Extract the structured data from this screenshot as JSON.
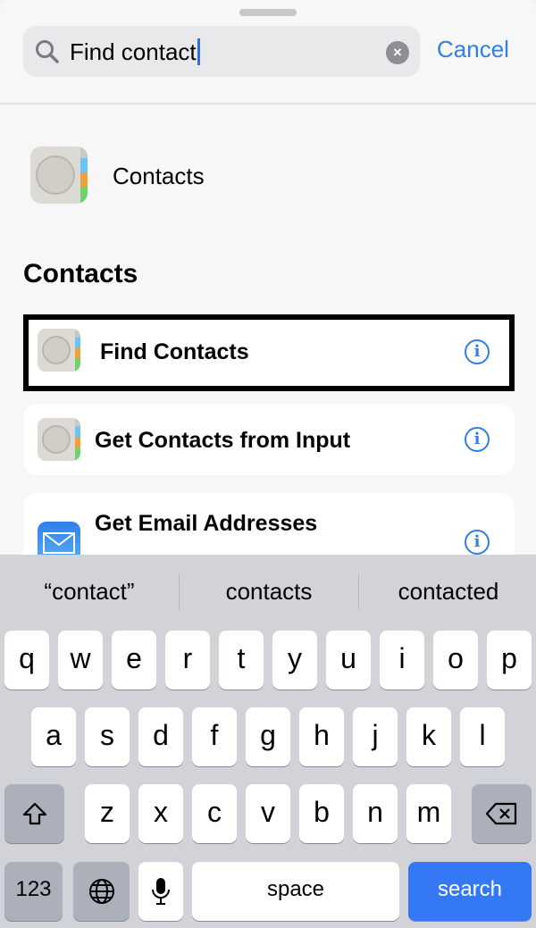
{
  "search": {
    "value": "Find contact",
    "cancel_label": "Cancel"
  },
  "app_result": {
    "label": "Contacts"
  },
  "section_title": "Contacts",
  "actions": [
    {
      "label": "Find Contacts",
      "selected": true
    },
    {
      "label": "Get Contacts from Input"
    },
    {
      "label": "Get Email Addresses"
    }
  ],
  "keyboard": {
    "suggestions": [
      "“contact”",
      "contacts",
      "contacted"
    ],
    "row1": [
      "q",
      "w",
      "e",
      "r",
      "t",
      "y",
      "u",
      "i",
      "o",
      "p"
    ],
    "row2": [
      "a",
      "s",
      "d",
      "f",
      "g",
      "h",
      "j",
      "k",
      "l"
    ],
    "row3": [
      "z",
      "x",
      "c",
      "v",
      "b",
      "n",
      "m"
    ],
    "numbers_label": "123",
    "space_label": "space",
    "search_label": "search"
  },
  "colors": {
    "accent": "#2f7fe6",
    "search_key": "#3478f6"
  }
}
